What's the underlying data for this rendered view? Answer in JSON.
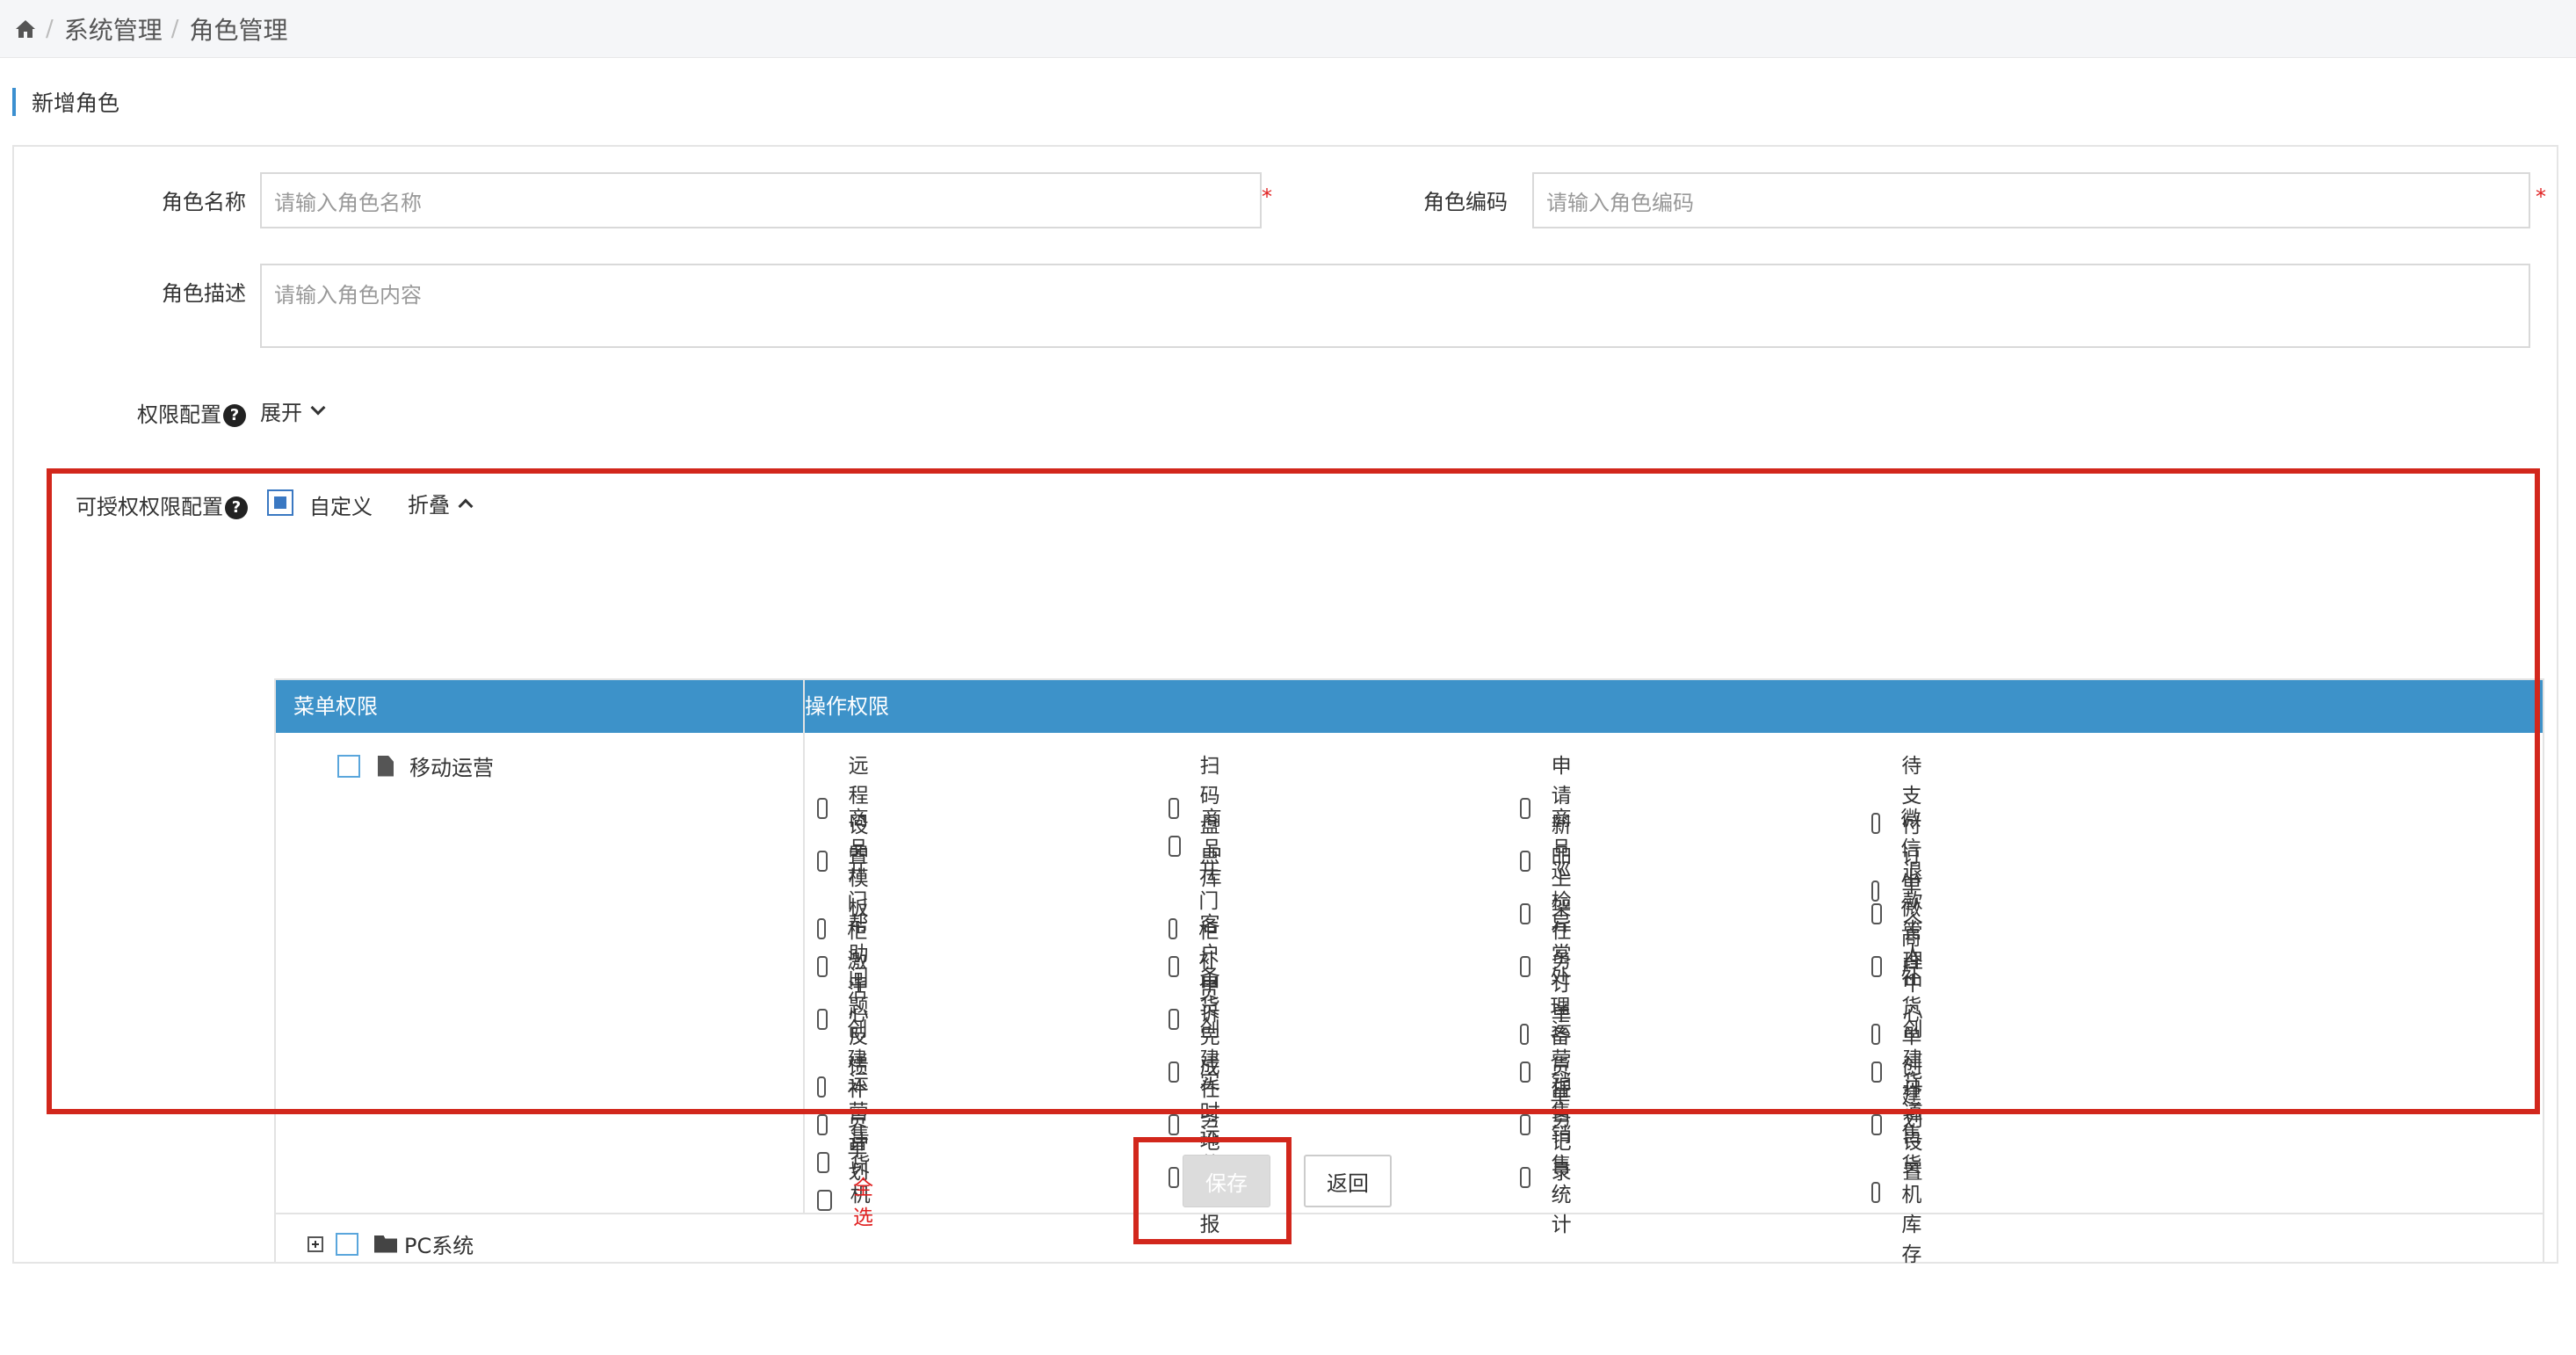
{
  "breadcrumb": {
    "items": [
      "系统管理",
      "角色管理"
    ],
    "sep": "/"
  },
  "section": {
    "title": "新增角色"
  },
  "form": {
    "role_name": {
      "label": "角色名称",
      "placeholder": "请输入角色名称",
      "required": "*"
    },
    "role_code": {
      "label": "角色编码",
      "placeholder": "请输入角色编码",
      "required": "*"
    },
    "role_desc": {
      "label": "角色描述",
      "placeholder": "请输入角色内容"
    },
    "perm_config": {
      "label": "权限配置",
      "toggle": "展开"
    },
    "grant_config": {
      "label": "可授权权限配置",
      "custom": "自定义",
      "toggle": "折叠"
    }
  },
  "table": {
    "col_menu": "菜单权限",
    "col_ops": "操作权限",
    "tree": [
      {
        "label": "移动运营",
        "icon": "document-icon"
      },
      {
        "label": "PC系统",
        "icon": "folder-icon"
      }
    ],
    "ops": [
      [
        "远程设置",
        "扫码盘点",
        "申请新品",
        "待支付订单"
      ],
      [
        "商品模板",
        "商品库",
        "商品上架",
        "微信小微商户"
      ],
      [
        "开门柜激活",
        "开门柜补货",
        "巡检任务",
        "退款管理"
      ],
      [
        "帮助中心",
        "客户申诉",
        "异常订单",
        "个人中心"
      ],
      [
        "问题反馈",
        "备货完成",
        "处理备货单",
        "补货单创建"
      ],
      [
        "创建补货单",
        "创建任务",
        "运营任务",
        "创建计划"
      ],
      [
        "运营计划",
        "实时地图",
        "销售记录",
        "货道设置"
      ],
      [
        "售货机",
        "运营日报",
        "销售统计",
        "售货机库存"
      ]
    ],
    "select_all": "全选"
  },
  "buttons": {
    "save": "保存",
    "back": "返回"
  },
  "colors": {
    "header": "#3d92c9",
    "highlight": "#d2271c",
    "required": "#e02020"
  }
}
